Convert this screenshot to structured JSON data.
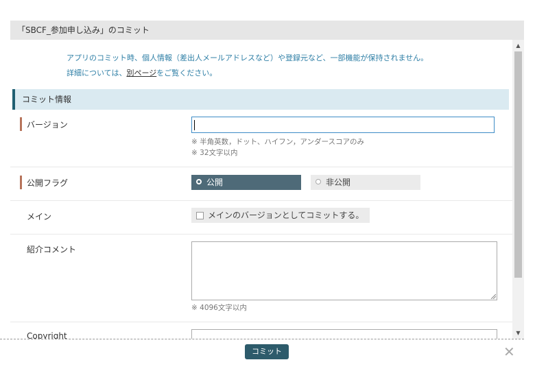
{
  "dialog": {
    "title": "「SBCF_参加申し込み」のコミット"
  },
  "notice": {
    "line1": "アプリのコミット時、個人情報（差出人メールアドレスなど）や登録元など、一部機能が保持されません。",
    "line2_prefix": "詳細については、",
    "line2_link": "別ページ",
    "line2_suffix": "をご覧ください。"
  },
  "section": {
    "title": "コミット情報"
  },
  "version": {
    "label": "バージョン",
    "value": "",
    "hint1": "※ 半角英数，ドット、ハイフン，アンダースコアのみ",
    "hint2": "※ 32文字以内"
  },
  "public_flag": {
    "label": "公開フラグ",
    "options": [
      {
        "label": "公開",
        "selected": true
      },
      {
        "label": "非公開",
        "selected": false
      }
    ]
  },
  "main": {
    "label": "メイン",
    "checkbox_label": "メインのバージョンとしてコミットする。",
    "checked": false
  },
  "intro_comment": {
    "label": "紹介コメント",
    "value": "",
    "hint": "※ 4096文字以内"
  },
  "copyright": {
    "label": "Copyright"
  },
  "footer": {
    "commit_label": "コミット",
    "close_icon": "close-icon"
  },
  "colors": {
    "accent": "#2d5b6b",
    "section_bg": "#daeaf1",
    "required_marker": "#b7735a",
    "selected_radio": "#4e6a78"
  }
}
